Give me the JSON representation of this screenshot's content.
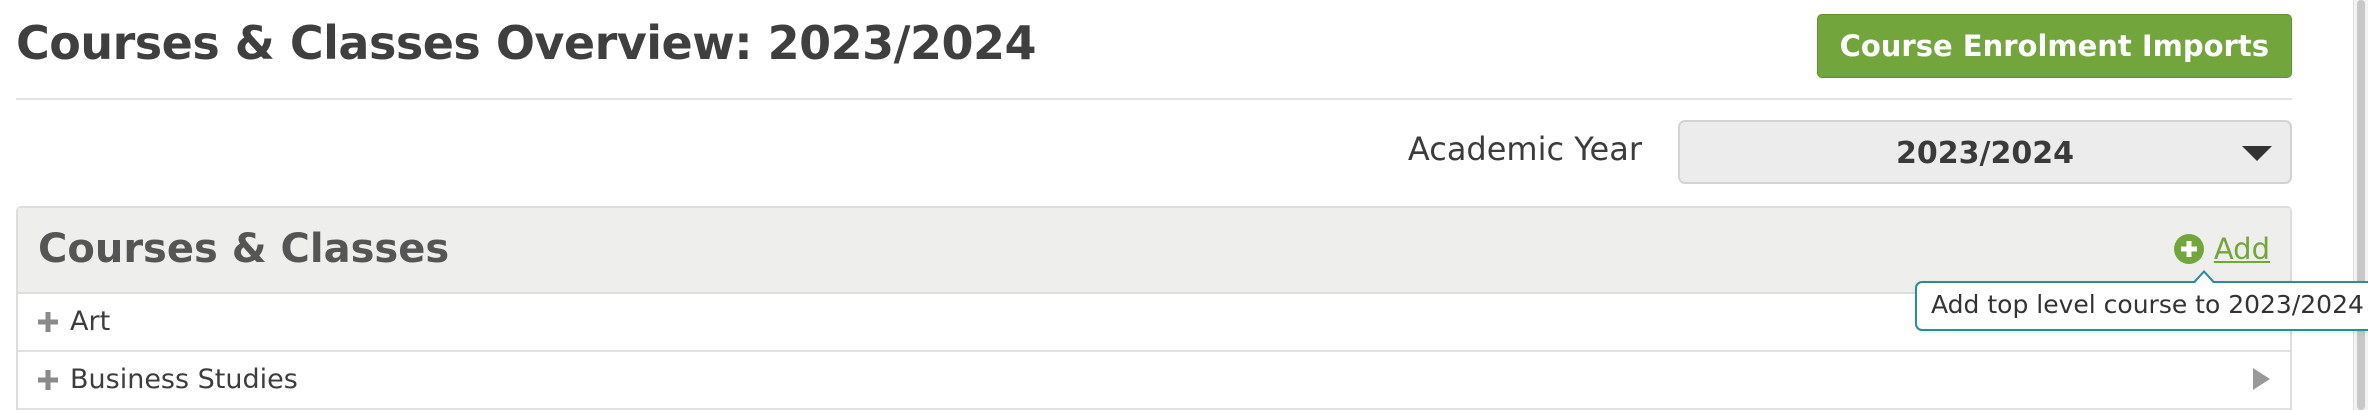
{
  "page": {
    "title": "Courses & Classes Overview: 2023/2024",
    "imports_button_label": "Course Enrolment Imports"
  },
  "filter": {
    "academic_year_label": "Academic Year",
    "academic_year_value": "2023/2024"
  },
  "panel": {
    "title": "Courses & Classes",
    "add_label": "Add",
    "add_tooltip": "Add top level course to 2023/2024"
  },
  "courses": [
    {
      "name": "Art"
    },
    {
      "name": "Business Studies"
    }
  ],
  "icons": {
    "add": "plus-circle-icon",
    "expand": "plus-icon",
    "select": "caret-down-icon",
    "row": "caret-right-icon"
  },
  "colors": {
    "accent_green": "#72a53c",
    "tooltip_border": "#2b8c9a",
    "panel_heading_bg": "#eeeeed"
  }
}
